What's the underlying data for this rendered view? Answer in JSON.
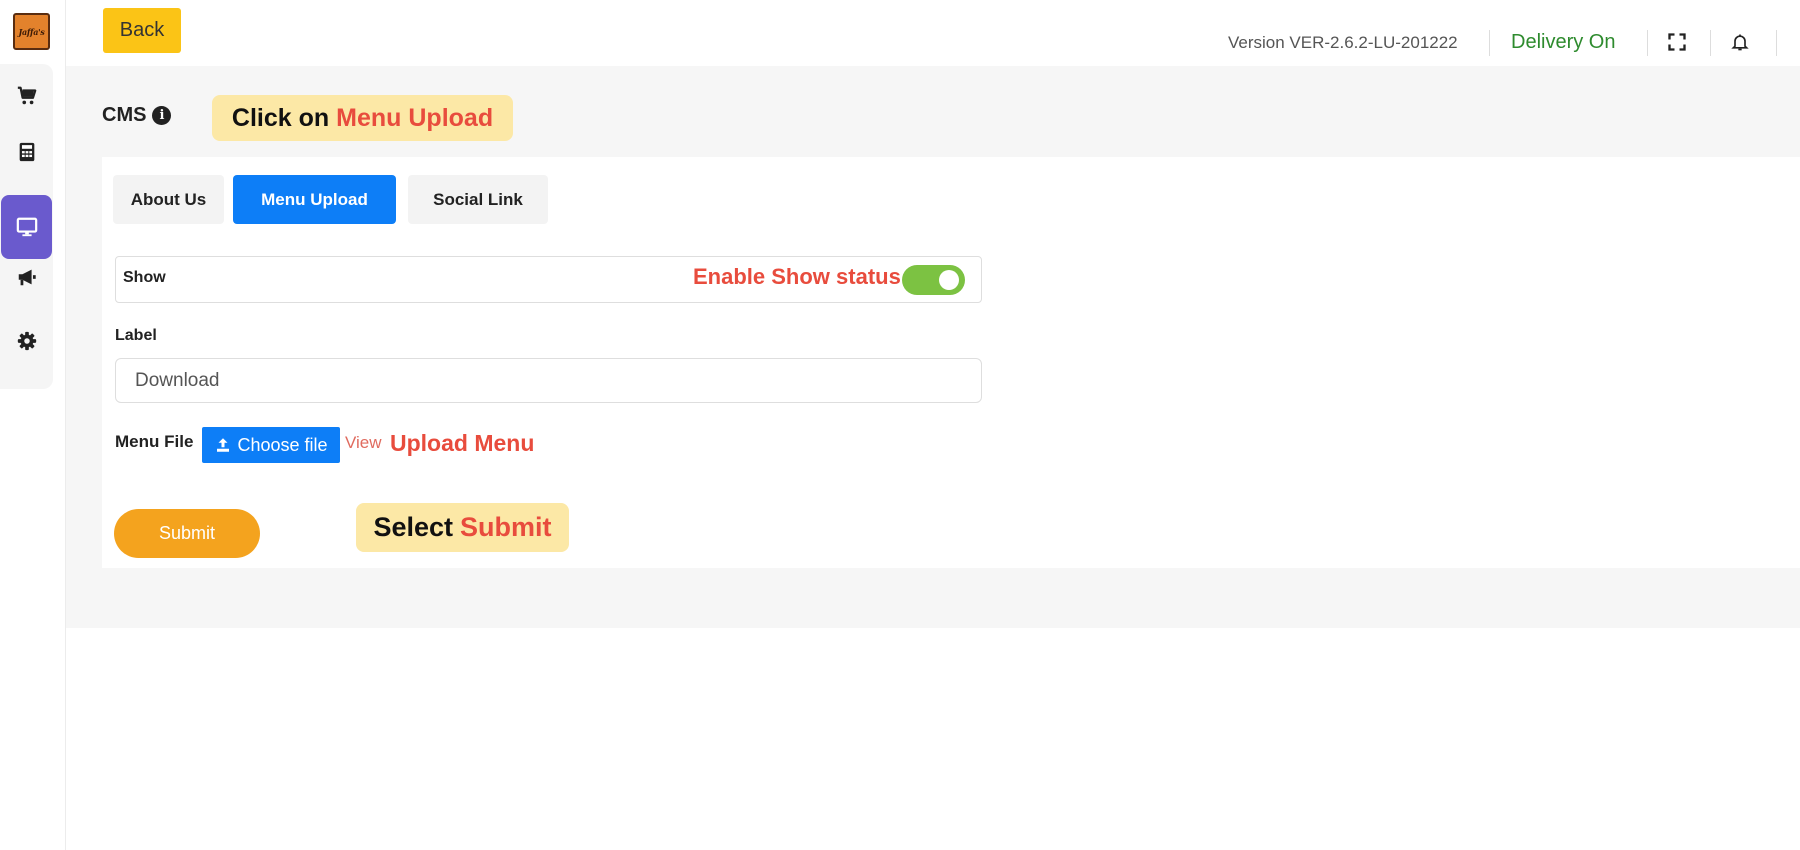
{
  "sidebar": {
    "logo_text": "Jaffa's",
    "items": [
      {
        "icon": "cart-icon"
      },
      {
        "icon": "calculator-icon"
      },
      {
        "icon": "monitor-icon",
        "active": true
      },
      {
        "icon": "megaphone-icon"
      },
      {
        "icon": "gear-icon"
      }
    ],
    "active_color": "#6a5acd"
  },
  "header": {
    "back_label": "Back",
    "version_text": "Version VER-2.6.2-LU-201222",
    "delivery_status": "Delivery On",
    "icons": [
      "fullscreen-icon",
      "bell-icon"
    ]
  },
  "page": {
    "title": "CMS",
    "title_icon": "info-icon"
  },
  "callouts": {
    "menu_upload": {
      "prefix": "Click on",
      "highlight": "Menu Upload"
    },
    "submit": {
      "prefix": "Select",
      "highlight": "Submit"
    },
    "enable_show": "Enable Show status",
    "upload_menu": "Upload Menu"
  },
  "tabs": [
    {
      "label": "About Us",
      "active": false
    },
    {
      "label": "Menu Upload",
      "active": true
    },
    {
      "label": "Social Link",
      "active": false
    }
  ],
  "form": {
    "show_label": "Show",
    "show_enabled": true,
    "label_field_label": "Label",
    "label_field_value": "Download",
    "menu_file_label": "Menu File",
    "choose_file_label": "Choose file",
    "view_label": "View",
    "submit_label": "Submit"
  },
  "colors": {
    "primary_blue": "#0d7ef7",
    "back_yellow": "#fbc416",
    "submit_orange": "#f4a31e",
    "delivery_green": "#2e8b2e",
    "toggle_green": "#7cc242",
    "annotation_red": "#e84c3d",
    "callout_bg": "#fce8a6"
  }
}
